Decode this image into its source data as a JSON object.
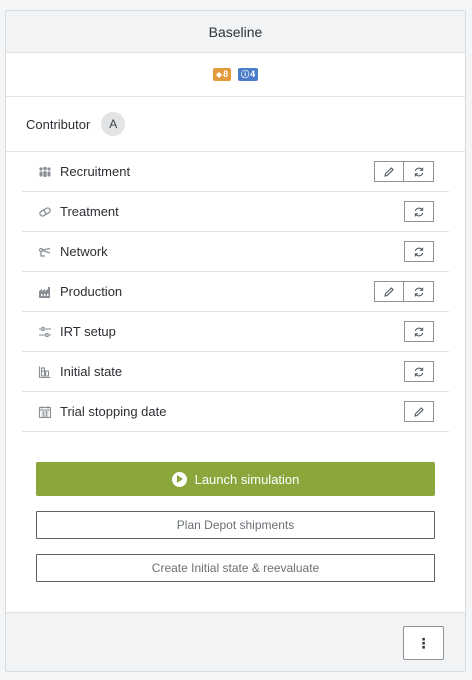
{
  "header": {
    "title": "Baseline"
  },
  "badges": [
    {
      "icon": "◆",
      "count": "8",
      "color": "#e29a3a",
      "icon_name": "diamond-icon"
    },
    {
      "icon": "ⓘ",
      "count": "4",
      "color": "#4a7ec9",
      "icon_name": "info-icon"
    }
  ],
  "contributor": {
    "label": "Contributor",
    "avatar": "A"
  },
  "rows": [
    {
      "label": "Recruitment",
      "icon": "people-icon",
      "edit": true,
      "refresh": true
    },
    {
      "label": "Treatment",
      "icon": "pill-icon",
      "edit": false,
      "refresh": true
    },
    {
      "label": "Network",
      "icon": "network-icon",
      "edit": false,
      "refresh": true
    },
    {
      "label": "Production",
      "icon": "factory-icon",
      "edit": true,
      "refresh": true
    },
    {
      "label": "IRT setup",
      "icon": "sliders-icon",
      "edit": false,
      "refresh": true
    },
    {
      "label": "Initial state",
      "icon": "grid-icon",
      "edit": false,
      "refresh": true
    },
    {
      "label": "Trial stopping date",
      "icon": "calendar-icon",
      "edit": true,
      "refresh": false
    }
  ],
  "actions": {
    "launch": "Launch simulation",
    "plan": "Plan Depot shipments",
    "create": "Create Initial state & reevaluate"
  },
  "footer": {
    "more": "⋮"
  }
}
